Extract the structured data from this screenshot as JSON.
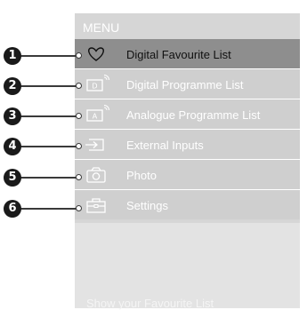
{
  "menu": {
    "header": "MENU",
    "items": [
      {
        "number": "1",
        "label": "Digital Favourite List",
        "icon": "heart-icon",
        "selected": true
      },
      {
        "number": "2",
        "label": "Digital Programme List",
        "icon": "digital-programme-icon",
        "selected": false
      },
      {
        "number": "3",
        "label": "Analogue Programme List",
        "icon": "analogue-programme-icon",
        "selected": false
      },
      {
        "number": "4",
        "label": "External Inputs",
        "icon": "external-input-icon",
        "selected": false
      },
      {
        "number": "5",
        "label": "Photo",
        "icon": "camera-icon",
        "selected": false
      },
      {
        "number": "6",
        "label": "Settings",
        "icon": "toolbox-icon",
        "selected": false
      }
    ],
    "footer_hint": "Show your Favourite List"
  },
  "colors": {
    "panel_bg": "#d6d6d6",
    "selected_bg": "#8e8e8e",
    "item_bg": "#cfcfcf",
    "text_white": "#ffffff",
    "callout_circle": "#1a1a1a"
  },
  "icons": {
    "digital_badge": "D",
    "analogue_badge": "A"
  }
}
